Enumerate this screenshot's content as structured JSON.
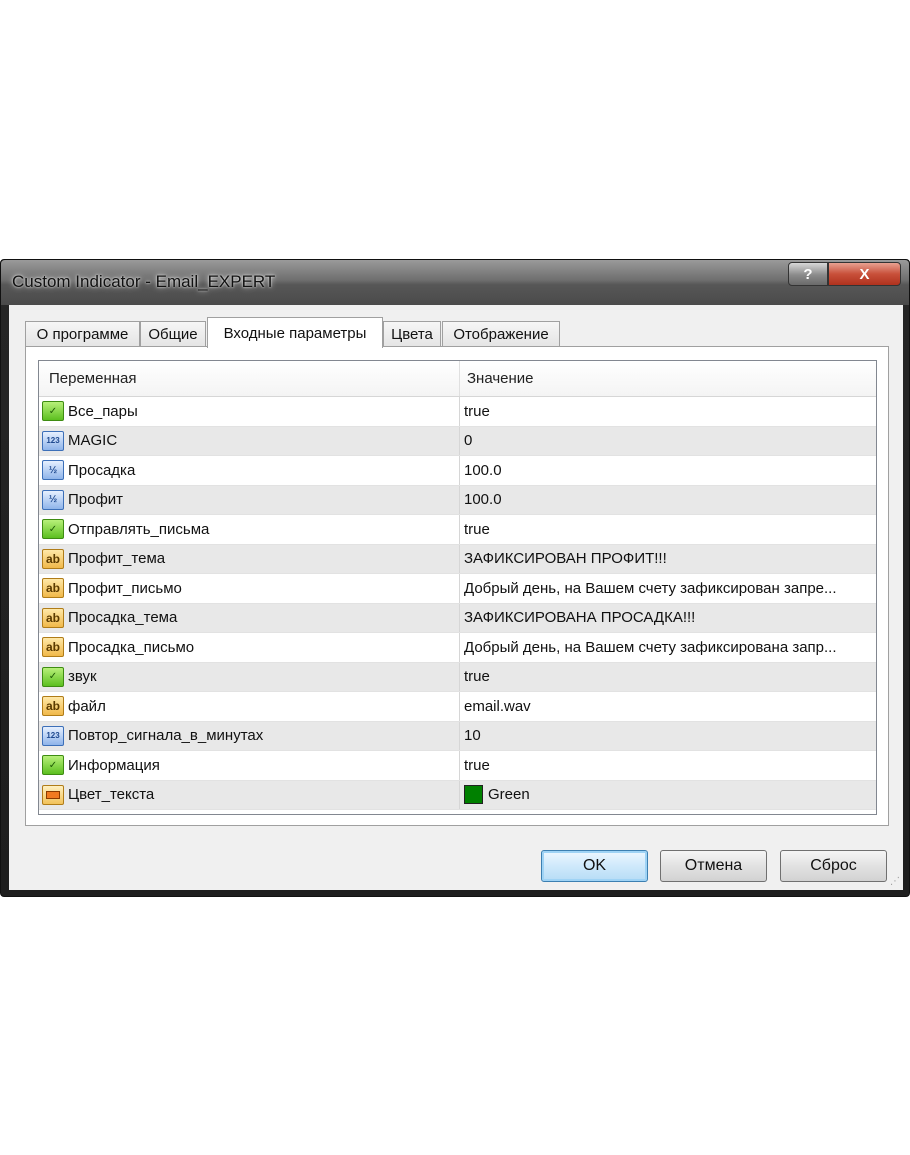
{
  "window": {
    "title": "Custom Indicator - Email_EXPERT",
    "help_label": "?",
    "close_label": "X"
  },
  "tabs": [
    {
      "label": "О программе"
    },
    {
      "label": "Общие"
    },
    {
      "label": "Входные параметры",
      "active": true
    },
    {
      "label": "Цвета"
    },
    {
      "label": "Отображение"
    }
  ],
  "table": {
    "headers": {
      "variable": "Переменная",
      "value": "Значение"
    },
    "rows": [
      {
        "icon": "bool-icon",
        "variable": "Все_пары",
        "value": "true"
      },
      {
        "icon": "int-icon",
        "variable": "MAGIC",
        "value": "0"
      },
      {
        "icon": "double-icon",
        "variable": "Просадка",
        "value": "100.0"
      },
      {
        "icon": "double-icon",
        "variable": "Профит",
        "value": "100.0"
      },
      {
        "icon": "bool-icon",
        "variable": "Отправлять_письма",
        "value": "true"
      },
      {
        "icon": "string-icon",
        "variable": "Профит_тема",
        "value": "ЗАФИКСИРОВАН ПРОФИТ!!!"
      },
      {
        "icon": "string-icon",
        "variable": "Профит_письмо",
        "value": "Добрый день, на Вашем счету зафиксирован запре..."
      },
      {
        "icon": "string-icon",
        "variable": "Просадка_тема",
        "value": "ЗАФИКСИРОВАНА ПРОСАДКА!!!"
      },
      {
        "icon": "string-icon",
        "variable": "Просадка_письмо",
        "value": "Добрый день, на Вашем счету зафиксирована запр..."
      },
      {
        "icon": "bool-icon",
        "variable": "звук",
        "value": "true"
      },
      {
        "icon": "string-icon",
        "variable": "файл",
        "value": "email.wav"
      },
      {
        "icon": "int-icon",
        "variable": "Повтор_сигнала_в_минутах",
        "value": "10"
      },
      {
        "icon": "bool-icon",
        "variable": "Информация",
        "value": "true"
      },
      {
        "icon": "color-icon",
        "variable": "Цвет_текста",
        "value": "Green",
        "swatch_color": "#008000"
      }
    ]
  },
  "icon_glyphs": {
    "bool": "✓",
    "int": "123",
    "double": "½",
    "string": "ab"
  },
  "buttons": {
    "ok": "OK",
    "cancel": "Отмена",
    "reset": "Сброс"
  },
  "colors": {
    "accent": "#3c7fb1",
    "row_alt": "#e8e8e8",
    "swatch": "#008000"
  }
}
